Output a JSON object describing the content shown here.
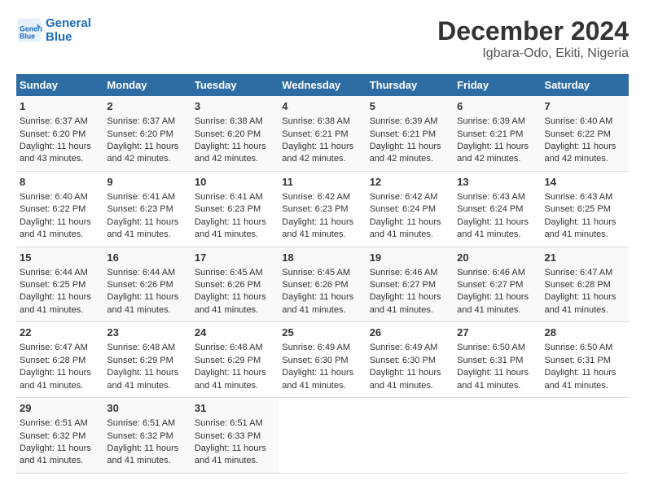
{
  "logo": {
    "line1": "General",
    "line2": "Blue"
  },
  "title": "December 2024",
  "subtitle": "Igbara-Odo, Ekiti, Nigeria",
  "days_of_week": [
    "Sunday",
    "Monday",
    "Tuesday",
    "Wednesday",
    "Thursday",
    "Friday",
    "Saturday"
  ],
  "weeks": [
    [
      {
        "day": "1",
        "sunrise": "6:37 AM",
        "sunset": "6:20 PM",
        "daylight": "11 hours and 43 minutes."
      },
      {
        "day": "2",
        "sunrise": "6:37 AM",
        "sunset": "6:20 PM",
        "daylight": "11 hours and 42 minutes."
      },
      {
        "day": "3",
        "sunrise": "6:38 AM",
        "sunset": "6:20 PM",
        "daylight": "11 hours and 42 minutes."
      },
      {
        "day": "4",
        "sunrise": "6:38 AM",
        "sunset": "6:21 PM",
        "daylight": "11 hours and 42 minutes."
      },
      {
        "day": "5",
        "sunrise": "6:39 AM",
        "sunset": "6:21 PM",
        "daylight": "11 hours and 42 minutes."
      },
      {
        "day": "6",
        "sunrise": "6:39 AM",
        "sunset": "6:21 PM",
        "daylight": "11 hours and 42 minutes."
      },
      {
        "day": "7",
        "sunrise": "6:40 AM",
        "sunset": "6:22 PM",
        "daylight": "11 hours and 42 minutes."
      }
    ],
    [
      {
        "day": "8",
        "sunrise": "6:40 AM",
        "sunset": "6:22 PM",
        "daylight": "11 hours and 41 minutes."
      },
      {
        "day": "9",
        "sunrise": "6:41 AM",
        "sunset": "6:23 PM",
        "daylight": "11 hours and 41 minutes."
      },
      {
        "day": "10",
        "sunrise": "6:41 AM",
        "sunset": "6:23 PM",
        "daylight": "11 hours and 41 minutes."
      },
      {
        "day": "11",
        "sunrise": "6:42 AM",
        "sunset": "6:23 PM",
        "daylight": "11 hours and 41 minutes."
      },
      {
        "day": "12",
        "sunrise": "6:42 AM",
        "sunset": "6:24 PM",
        "daylight": "11 hours and 41 minutes."
      },
      {
        "day": "13",
        "sunrise": "6:43 AM",
        "sunset": "6:24 PM",
        "daylight": "11 hours and 41 minutes."
      },
      {
        "day": "14",
        "sunrise": "6:43 AM",
        "sunset": "6:25 PM",
        "daylight": "11 hours and 41 minutes."
      }
    ],
    [
      {
        "day": "15",
        "sunrise": "6:44 AM",
        "sunset": "6:25 PM",
        "daylight": "11 hours and 41 minutes."
      },
      {
        "day": "16",
        "sunrise": "6:44 AM",
        "sunset": "6:26 PM",
        "daylight": "11 hours and 41 minutes."
      },
      {
        "day": "17",
        "sunrise": "6:45 AM",
        "sunset": "6:26 PM",
        "daylight": "11 hours and 41 minutes."
      },
      {
        "day": "18",
        "sunrise": "6:45 AM",
        "sunset": "6:26 PM",
        "daylight": "11 hours and 41 minutes."
      },
      {
        "day": "19",
        "sunrise": "6:46 AM",
        "sunset": "6:27 PM",
        "daylight": "11 hours and 41 minutes."
      },
      {
        "day": "20",
        "sunrise": "6:46 AM",
        "sunset": "6:27 PM",
        "daylight": "11 hours and 41 minutes."
      },
      {
        "day": "21",
        "sunrise": "6:47 AM",
        "sunset": "6:28 PM",
        "daylight": "11 hours and 41 minutes."
      }
    ],
    [
      {
        "day": "22",
        "sunrise": "6:47 AM",
        "sunset": "6:28 PM",
        "daylight": "11 hours and 41 minutes."
      },
      {
        "day": "23",
        "sunrise": "6:48 AM",
        "sunset": "6:29 PM",
        "daylight": "11 hours and 41 minutes."
      },
      {
        "day": "24",
        "sunrise": "6:48 AM",
        "sunset": "6:29 PM",
        "daylight": "11 hours and 41 minutes."
      },
      {
        "day": "25",
        "sunrise": "6:49 AM",
        "sunset": "6:30 PM",
        "daylight": "11 hours and 41 minutes."
      },
      {
        "day": "26",
        "sunrise": "6:49 AM",
        "sunset": "6:30 PM",
        "daylight": "11 hours and 41 minutes."
      },
      {
        "day": "27",
        "sunrise": "6:50 AM",
        "sunset": "6:31 PM",
        "daylight": "11 hours and 41 minutes."
      },
      {
        "day": "28",
        "sunrise": "6:50 AM",
        "sunset": "6:31 PM",
        "daylight": "11 hours and 41 minutes."
      }
    ],
    [
      {
        "day": "29",
        "sunrise": "6:51 AM",
        "sunset": "6:32 PM",
        "daylight": "11 hours and 41 minutes."
      },
      {
        "day": "30",
        "sunrise": "6:51 AM",
        "sunset": "6:32 PM",
        "daylight": "11 hours and 41 minutes."
      },
      {
        "day": "31",
        "sunrise": "6:51 AM",
        "sunset": "6:33 PM",
        "daylight": "11 hours and 41 minutes."
      },
      null,
      null,
      null,
      null
    ]
  ]
}
